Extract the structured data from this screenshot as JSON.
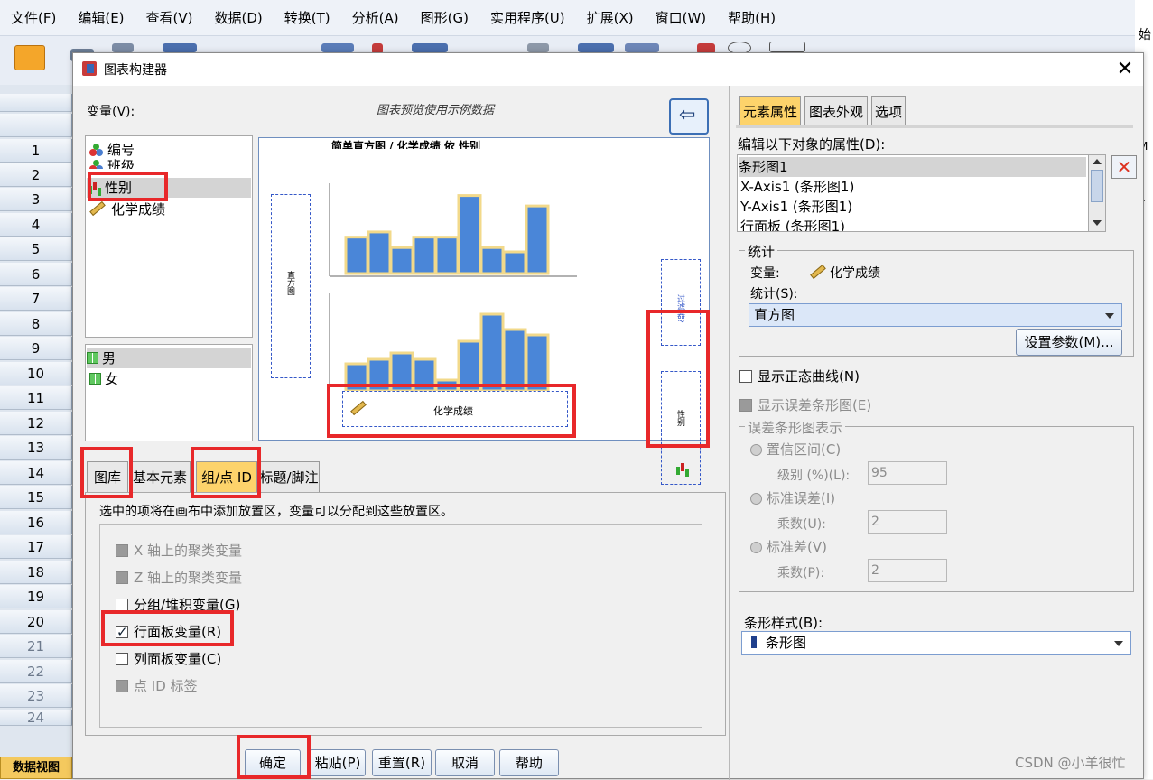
{
  "menu": [
    "文件(F)",
    "编辑(E)",
    "查看(V)",
    "数据(D)",
    "转换(T)",
    "分析(A)",
    "图形(G)",
    "实用程序(U)",
    "扩展(X)",
    "窗口(W)",
    "帮助(H)"
  ],
  "edge_text": [
    "始",
    "M",
    "L"
  ],
  "row_numbers": [
    "1",
    "2",
    "3",
    "4",
    "5",
    "6",
    "7",
    "8",
    "9",
    "10",
    "11",
    "12",
    "13",
    "14",
    "15",
    "16",
    "17",
    "18",
    "19",
    "20",
    "21",
    "22",
    "23",
    "24"
  ],
  "data_view_tab": "数据视图",
  "dialog": {
    "title": "图表构建器",
    "variables_label": "变量(V):",
    "preview_caption": "图表预览使用示例数据",
    "variables": [
      {
        "name": "编号",
        "icon": "nominal-icon"
      },
      {
        "name": "班级",
        "icon": "nominal-icon"
      },
      {
        "name": "性别",
        "icon": "bar-chart-icon"
      },
      {
        "name": "化学成绩",
        "icon": "ruler-icon"
      }
    ],
    "categories": [
      "男",
      "女"
    ],
    "canvas": {
      "title": "简单直方图 / 化学成绩 依 性别",
      "y_drop_text": "直方图",
      "right_drop_top_text": "过滤器?",
      "right_drop_panel_text": "性别",
      "x_drop_text": "化学成绩"
    },
    "tabs": [
      "图库",
      "基本元素",
      "组/点 ID",
      "标题/脚注"
    ],
    "tab_description": "选中的项将在画布中添加放置区，变量可以分配到这些放置区。",
    "options": [
      {
        "label": "X 轴上的聚类变量",
        "state": "disabled"
      },
      {
        "label": "Z 轴上的聚类变量",
        "state": "disabled"
      },
      {
        "label": "分组/堆积变量(G)",
        "state": "unchecked"
      },
      {
        "label": "行面板变量(R)",
        "state": "checked"
      },
      {
        "label": "列面板变量(C)",
        "state": "unchecked"
      },
      {
        "label": "点 ID 标签",
        "state": "disabled"
      }
    ],
    "buttons": {
      "ok": "确定",
      "paste": "粘贴(P)",
      "reset": "重置(R)",
      "cancel": "取消",
      "help": "帮助"
    },
    "right_tabs": [
      "元素属性",
      "图表外观",
      "选项"
    ],
    "edit_props_label": "编辑以下对象的属性(D):",
    "objects": [
      "条形图1",
      "X-Axis1 (条形图1)",
      "Y-Axis1 (条形图1)",
      "行面板 (条形图1)"
    ],
    "stats": {
      "legend": "统计",
      "variable_label": "变量:",
      "variable_value": "化学成绩",
      "stat_label": "统计(S):",
      "stat_value": "直方图",
      "params_button": "设置参数(M)..."
    },
    "normal_curve": "显示正态曲线(N)",
    "error_bars": "显示误差条形图(E)",
    "error_section": {
      "legend": "误差条形图表示",
      "ci": "置信区间(C)",
      "level_label": "级别 (%)(L):",
      "level_value": "95",
      "se": "标准误差(I)",
      "multiplier_u_label": "乘数(U):",
      "multiplier_u_value": "2",
      "sd": "标准差(V)",
      "multiplier_p_label": "乘数(P):",
      "multiplier_p_value": "2"
    },
    "bar_style_label": "条形样式(B):",
    "bar_style_value": "条形图"
  },
  "watermark": "CSDN @小羊很忙",
  "colors": {
    "accent_tab": "#fdd36b",
    "highlight_red": "#e8282a",
    "bar_fill": "#4a86d8",
    "bar_halo": "#f2d98a"
  }
}
